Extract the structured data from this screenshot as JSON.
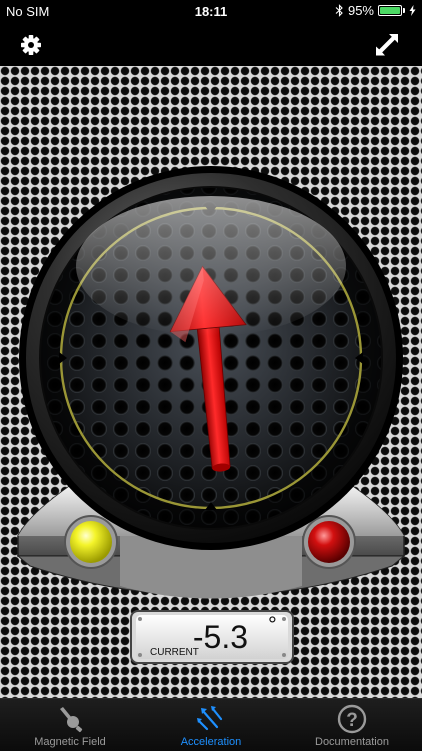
{
  "status_bar": {
    "carrier": "No SIM",
    "time": "18:11",
    "battery_percent": "95%",
    "battery_level": 0.95
  },
  "instrument": {
    "reading_value": "-5.3",
    "reading_unit": "°",
    "reading_label": "CURRENT",
    "arrow_rotation_deg": -5.3,
    "left_indicator_color": "#f4f42a",
    "right_indicator_color": "#d31010",
    "ring_color": "#9a9636",
    "arrow_color": "#e81818"
  },
  "tabs": [
    {
      "label": "Magnetic Field",
      "icon": "magnet-probe-icon",
      "active": false
    },
    {
      "label": "Acceleration",
      "icon": "acceleration-arrows-icon",
      "active": true
    },
    {
      "label": "Documentation",
      "icon": "help-circle-icon",
      "active": false
    }
  ],
  "colors": {
    "accent": "#1e90ff",
    "inactive": "#9a9a9a",
    "battery": "#4cd964"
  }
}
